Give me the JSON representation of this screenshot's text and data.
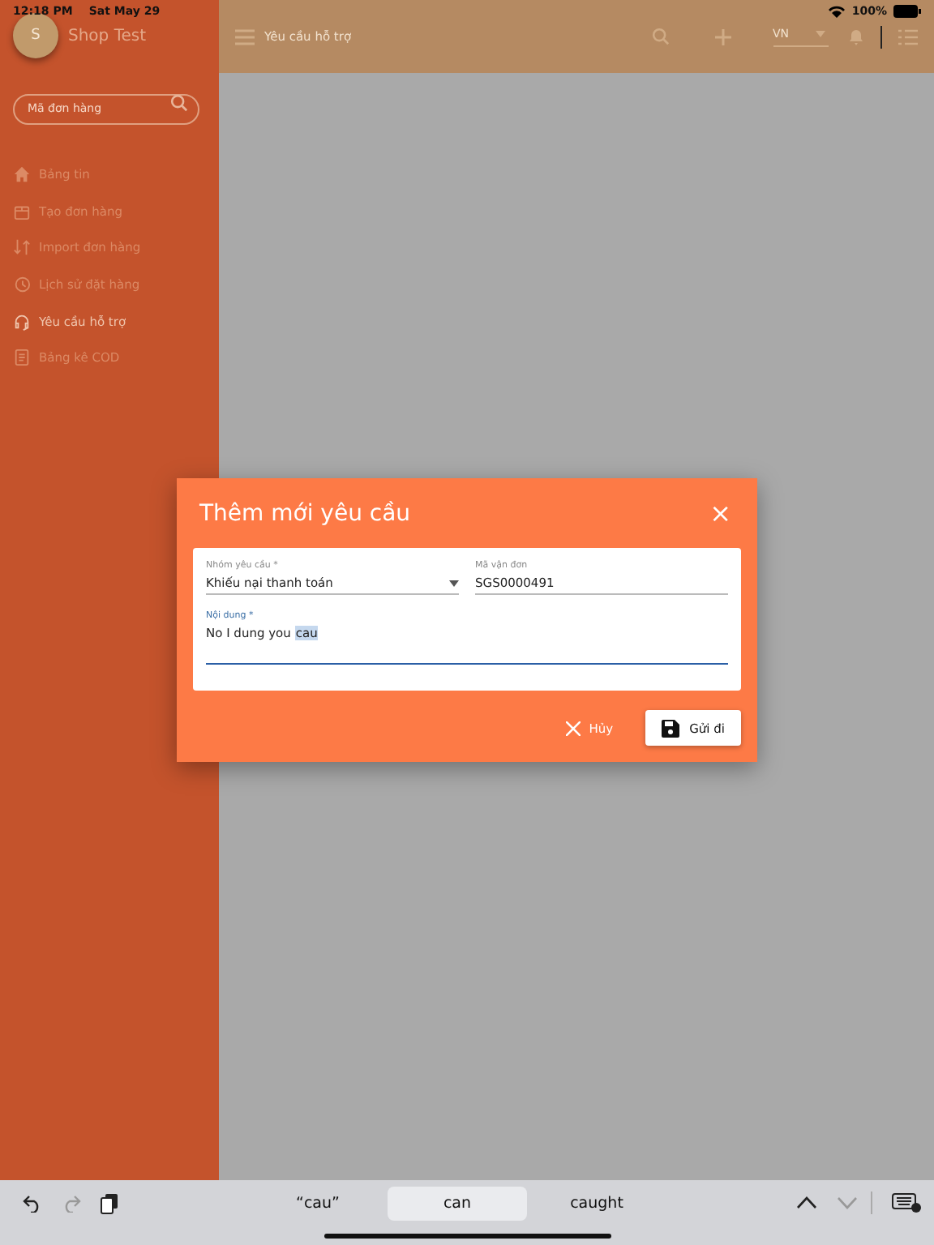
{
  "status_bar": {
    "time": "12:18 PM",
    "date": "Sat May 29",
    "battery": "100%"
  },
  "sidebar": {
    "avatar": "S",
    "shop_name": "Shop Test",
    "search": {
      "placeholder": "Mã đơn hàng"
    },
    "items": [
      {
        "label": "Bảng tin",
        "selected": false
      },
      {
        "label": "Tạo đơn hàng",
        "selected": false
      },
      {
        "label": "Import đơn hàng",
        "selected": false
      },
      {
        "label": "Lịch sử đặt hàng",
        "selected": false
      },
      {
        "label": "Yêu cầu hỗ trợ",
        "selected": true
      },
      {
        "label": "Bảng kê COD",
        "selected": false
      }
    ]
  },
  "top_bar": {
    "title": "Yêu cầu hỗ trợ",
    "language": "VN"
  },
  "dialog": {
    "title": "Thêm mới yêu cầu",
    "close": "×",
    "group": {
      "label": "Nhóm yêu cầu *",
      "value": "Khiếu nại thanh toán"
    },
    "waybill": {
      "label": "Mã vận đơn",
      "value": "SGS0000491"
    },
    "content": {
      "label": "Nội dung *",
      "parts": [
        {
          "text": "No I dung you",
          "selected": false
        },
        {
          "text": "cau",
          "selected": true
        }
      ]
    },
    "cancel": "Hủy",
    "submit": "Gửi đi"
  },
  "keyboard_bar": {
    "suggestions": [
      {
        "text": "“cau”",
        "selected": false
      },
      {
        "text": "can",
        "selected": true
      },
      {
        "text": "caught",
        "selected": false
      }
    ]
  }
}
